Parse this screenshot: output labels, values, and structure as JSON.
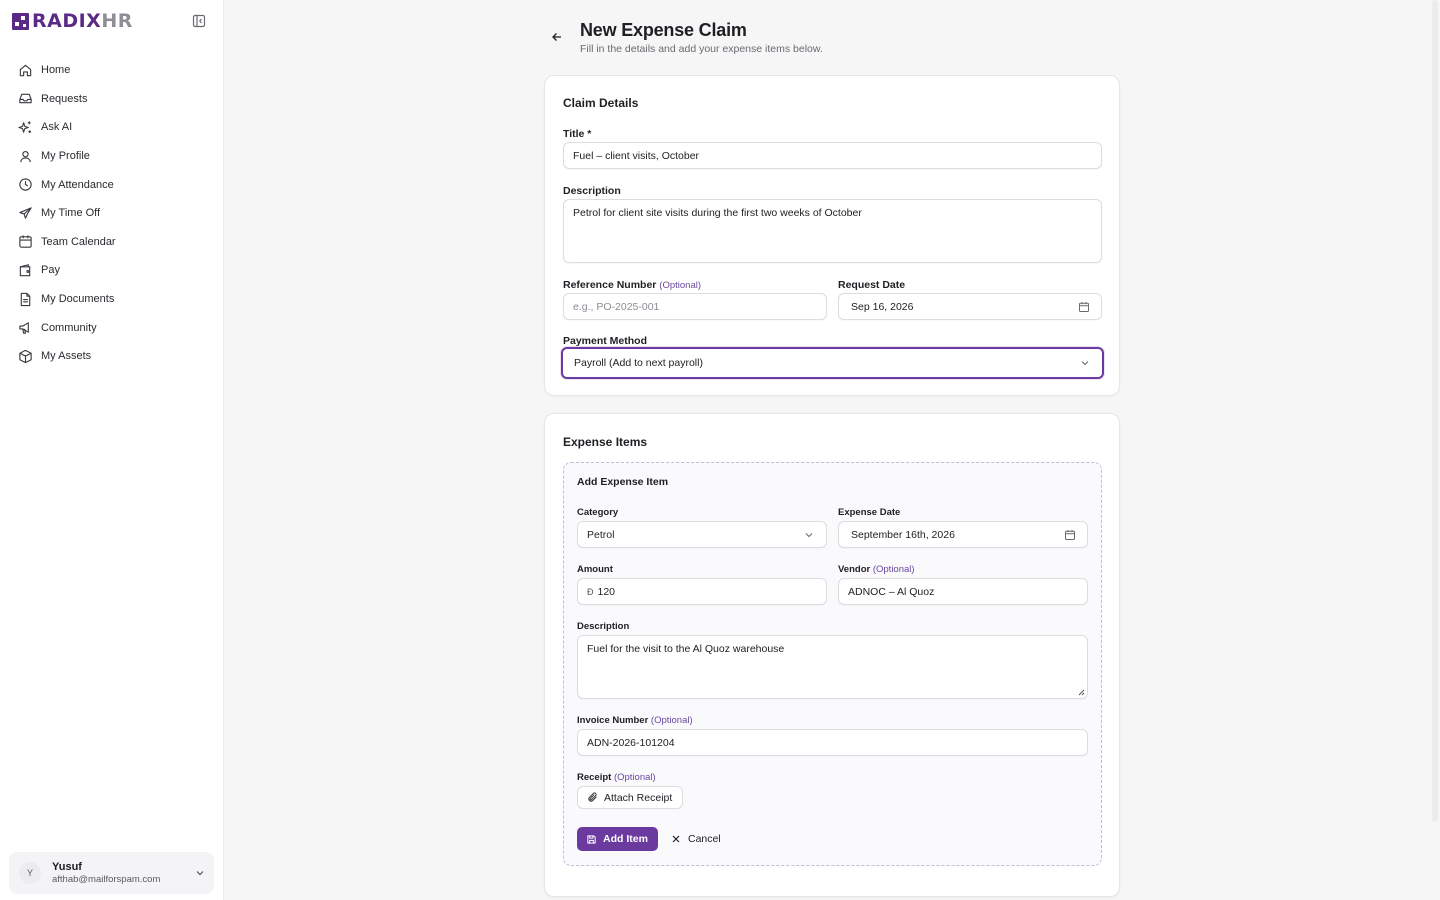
{
  "app": {
    "logo_primary": "RADIX",
    "logo_secondary": "HR",
    "brand_color": "#5b2a86"
  },
  "sidebar": {
    "items": [
      {
        "label": "Home",
        "icon": "home-icon"
      },
      {
        "label": "Requests",
        "icon": "inbox-icon"
      },
      {
        "label": "Ask AI",
        "icon": "sparkles-icon"
      },
      {
        "label": "My Profile",
        "icon": "user-icon"
      },
      {
        "label": "My Attendance",
        "icon": "clock-icon"
      },
      {
        "label": "My Time Off",
        "icon": "plane-icon"
      },
      {
        "label": "Team Calendar",
        "icon": "calendar-icon"
      },
      {
        "label": "Pay",
        "icon": "wallet-icon"
      },
      {
        "label": "My Documents",
        "icon": "document-icon"
      },
      {
        "label": "Community",
        "icon": "megaphone-icon"
      },
      {
        "label": "My Assets",
        "icon": "box-icon"
      }
    ],
    "user": {
      "initial": "Y",
      "name": "Yusuf",
      "email": "afthab@mailforspam.com"
    }
  },
  "page": {
    "title": "New Expense Claim",
    "subtitle": "Fill in the details and add your expense items below."
  },
  "claim_details": {
    "section_title": "Claim Details",
    "title_label": "Title *",
    "title_value": "Fuel – client visits, October",
    "description_label": "Description",
    "description_value": "Petrol for client site visits during the first two weeks of October",
    "reference_label": "Reference Number",
    "optional": "(Optional)",
    "reference_placeholder": "e.g., PO-2025-001",
    "request_date_label": "Request Date",
    "request_date_value": "Sep 16, 2026",
    "payment_method_label": "Payment Method",
    "payment_method_value": "Payroll (Add to next payroll)"
  },
  "expense_items": {
    "section_title": "Expense Items",
    "form_title": "Add Expense Item",
    "category_label": "Category",
    "category_value": "Petrol",
    "expense_date_label": "Expense Date",
    "expense_date_value": "September 16th, 2026",
    "amount_label": "Amount",
    "currency_symbol": "Đ",
    "amount_value": "120",
    "vendor_label": "Vendor",
    "vendor_value": "ADNOC – Al Quoz",
    "description_label": "Description",
    "description_value": "Fuel for the visit to the Al Quoz warehouse",
    "invoice_label": "Invoice Number",
    "invoice_value": "ADN-2026-101204",
    "receipt_label": "Receipt",
    "attach_label": "Attach Receipt",
    "add_item_label": "Add Item",
    "cancel_label": "Cancel"
  }
}
